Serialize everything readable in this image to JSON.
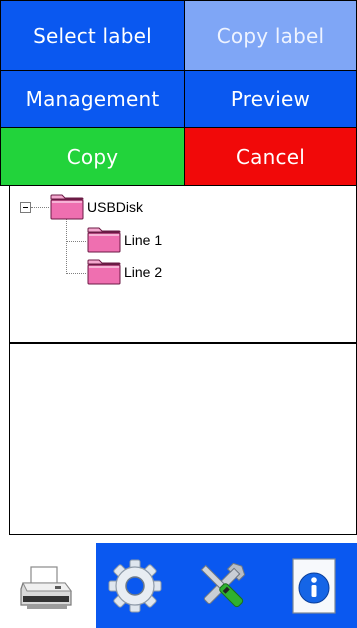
{
  "buttons": {
    "select_label": "Select label",
    "copy_label": "Copy label",
    "management": "Management",
    "preview": "Preview",
    "copy": "Copy",
    "cancel": "Cancel"
  },
  "tree": {
    "root": {
      "label": "USBDisk",
      "expanded": true,
      "icon": "folder-icon"
    },
    "children": [
      {
        "label": "Line 1",
        "icon": "folder-icon"
      },
      {
        "label": "Line 2",
        "icon": "folder-icon"
      }
    ]
  },
  "toolbar": {
    "items": [
      {
        "icon": "printer-icon",
        "selected": true
      },
      {
        "icon": "gear-icon"
      },
      {
        "icon": "tools-icon"
      },
      {
        "icon": "info-icon"
      }
    ]
  },
  "colors": {
    "blue": "#0a58f0",
    "disabled_blue": "#7fa6f6",
    "green": "#22d33b",
    "red": "#f10909",
    "folder_pink": "#ef6fb0"
  }
}
